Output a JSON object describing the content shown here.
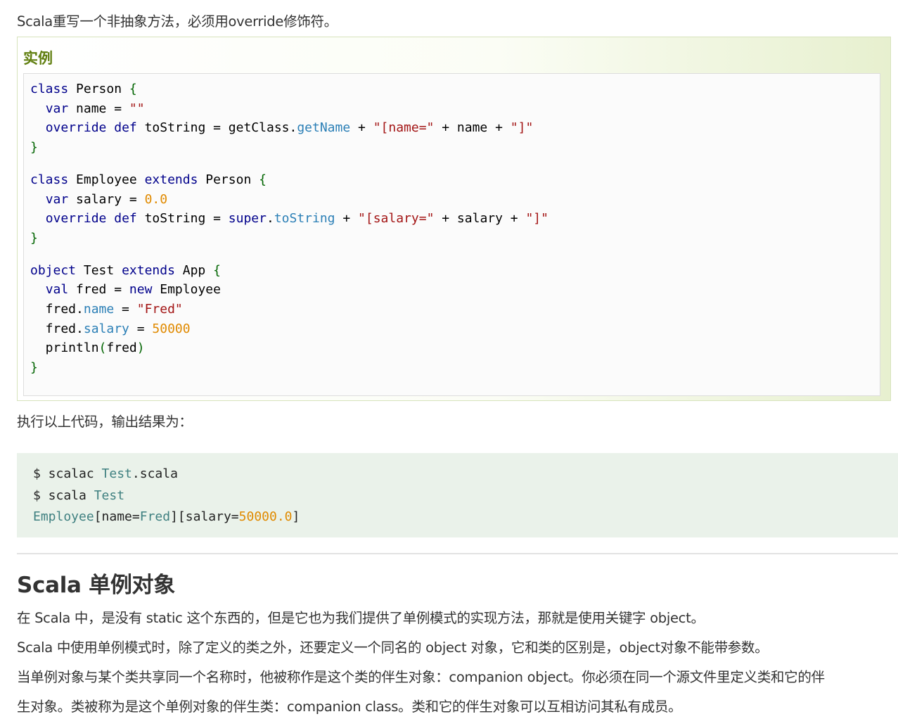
{
  "intro": "Scala重写一个非抽象方法，必须用override修饰符。",
  "example": {
    "title": "实例",
    "code": [
      [
        [
          "kw",
          "class"
        ],
        [
          "t",
          " Person "
        ],
        [
          "br",
          "{"
        ]
      ],
      [
        [
          "t",
          "  "
        ],
        [
          "kw",
          "var"
        ],
        [
          "t",
          " name = "
        ],
        [
          "str",
          "\"\""
        ]
      ],
      [
        [
          "t",
          "  "
        ],
        [
          "kw",
          "override"
        ],
        [
          "t",
          " "
        ],
        [
          "kw",
          "def"
        ],
        [
          "t",
          " toString = getClass."
        ],
        [
          "prop",
          "getName"
        ],
        [
          "t",
          " + "
        ],
        [
          "str",
          "\"[name=\""
        ],
        [
          "t",
          " + name + "
        ],
        [
          "str",
          "\"]\""
        ]
      ],
      [
        [
          "br",
          "}"
        ]
      ],
      [],
      [
        [
          "kw",
          "class"
        ],
        [
          "t",
          " Employee "
        ],
        [
          "kw",
          "extends"
        ],
        [
          "t",
          " Person "
        ],
        [
          "br",
          "{"
        ]
      ],
      [
        [
          "t",
          "  "
        ],
        [
          "kw",
          "var"
        ],
        [
          "t",
          " salary = "
        ],
        [
          "num",
          "0.0"
        ]
      ],
      [
        [
          "t",
          "  "
        ],
        [
          "kw",
          "override"
        ],
        [
          "t",
          " "
        ],
        [
          "kw",
          "def"
        ],
        [
          "t",
          " toString = "
        ],
        [
          "kw",
          "super"
        ],
        [
          "t",
          "."
        ],
        [
          "prop",
          "toString"
        ],
        [
          "t",
          " + "
        ],
        [
          "str",
          "\"[salary=\""
        ],
        [
          "t",
          " + salary + "
        ],
        [
          "str",
          "\"]\""
        ]
      ],
      [
        [
          "br",
          "}"
        ]
      ],
      [],
      [
        [
          "kw",
          "object"
        ],
        [
          "t",
          " Test "
        ],
        [
          "kw",
          "extends"
        ],
        [
          "t",
          " App "
        ],
        [
          "br",
          "{"
        ]
      ],
      [
        [
          "t",
          "  "
        ],
        [
          "kw",
          "val"
        ],
        [
          "t",
          " fred = "
        ],
        [
          "kw",
          "new"
        ],
        [
          "t",
          " Employee"
        ]
      ],
      [
        [
          "t",
          "  fred."
        ],
        [
          "prop",
          "name"
        ],
        [
          "t",
          " = "
        ],
        [
          "str",
          "\"Fred\""
        ]
      ],
      [
        [
          "t",
          "  fred."
        ],
        [
          "prop",
          "salary"
        ],
        [
          "t",
          " = "
        ],
        [
          "num",
          "50000"
        ]
      ],
      [
        [
          "t",
          "  println"
        ],
        [
          "br",
          "("
        ],
        [
          "t",
          "fred"
        ],
        [
          "br",
          ")"
        ]
      ],
      [
        [
          "br",
          "}"
        ]
      ]
    ]
  },
  "output_intro": "执行以上代码，输出结果为：",
  "output": [
    [
      [
        "t",
        "$ scalac "
      ],
      [
        "t1",
        "Test"
      ],
      [
        "t",
        ".scala"
      ]
    ],
    [
      [
        "t",
        "$ scala "
      ],
      [
        "t1",
        "Test"
      ]
    ],
    [
      [
        "t1",
        "Employee"
      ],
      [
        "t",
        "[name="
      ],
      [
        "t1",
        "Fred"
      ],
      [
        "t",
        "][salary="
      ],
      [
        "t2",
        "50000.0"
      ],
      [
        "t",
        "]"
      ]
    ]
  ],
  "section_title": "Scala 单例对象",
  "paragraphs": [
    "在 Scala 中，是没有 static 这个东西的，但是它也为我们提供了单例模式的实现方法，那就是使用关键字 object。",
    "Scala 中使用单例模式时，除了定义的类之外，还要定义一个同名的 object 对象，它和类的区别是，object对象不能带参数。",
    "当单例对象与某个类共享同一个名称时，他被称作是这个类的伴生对象：companion object。你必须在同一个源文件里定义类和它的伴",
    "生对象。类被称为是这个单例对象的伴生类：companion class。类和它的伴生对象可以互相访问其私有成员。"
  ]
}
